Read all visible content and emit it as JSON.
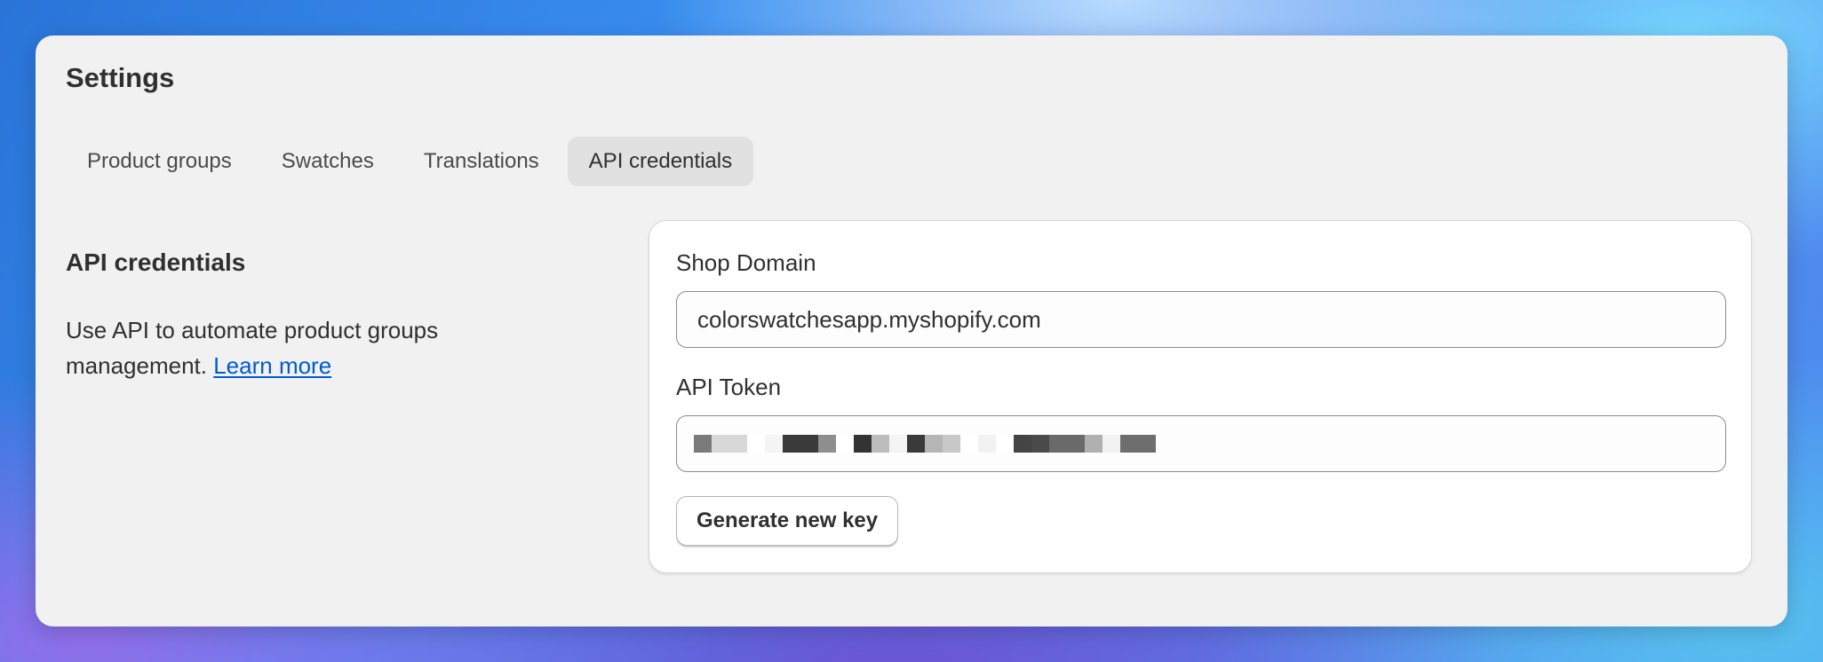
{
  "page": {
    "title": "Settings"
  },
  "tabs": [
    {
      "label": "Product groups",
      "active": false
    },
    {
      "label": "Swatches",
      "active": false
    },
    {
      "label": "Translations",
      "active": false
    },
    {
      "label": "API credentials",
      "active": true
    }
  ],
  "section": {
    "title": "API credentials",
    "description": "Use API to automate product groups management.",
    "link_label": "Learn more"
  },
  "form": {
    "shop_domain": {
      "label": "Shop Domain",
      "value": "colorswatchesapp.myshopify.com"
    },
    "api_token": {
      "label": "API Token",
      "value_pixelated": true,
      "pixel_colors": [
        "#7a7a7a",
        "#d8d8d8",
        "#d8d8d8",
        "#ffffff",
        "#f4f4f4",
        "#3a3a3a",
        "#3a3a3a",
        "#8e8e8e",
        "#ffffff",
        "#333333",
        "#bdbdbd",
        "#f4f4f4",
        "#3a3a3a",
        "#b5b5b5",
        "#c8c8c8",
        "#ffffff",
        "#f2f2f2",
        "#ffffff",
        "#444444",
        "#4a4a4a",
        "#6a6a6a",
        "#6a6a6a",
        "#b0b0b0",
        "#f2f2f2",
        "#6e6e6e",
        "#6e6e6e"
      ]
    },
    "generate_button": "Generate new key"
  },
  "colors": {
    "window_bg": "#f1f1f1",
    "card_bg": "#ffffff",
    "link": "#005bd3",
    "text": "#303030",
    "active_tab_bg": "#e1e1e1"
  }
}
